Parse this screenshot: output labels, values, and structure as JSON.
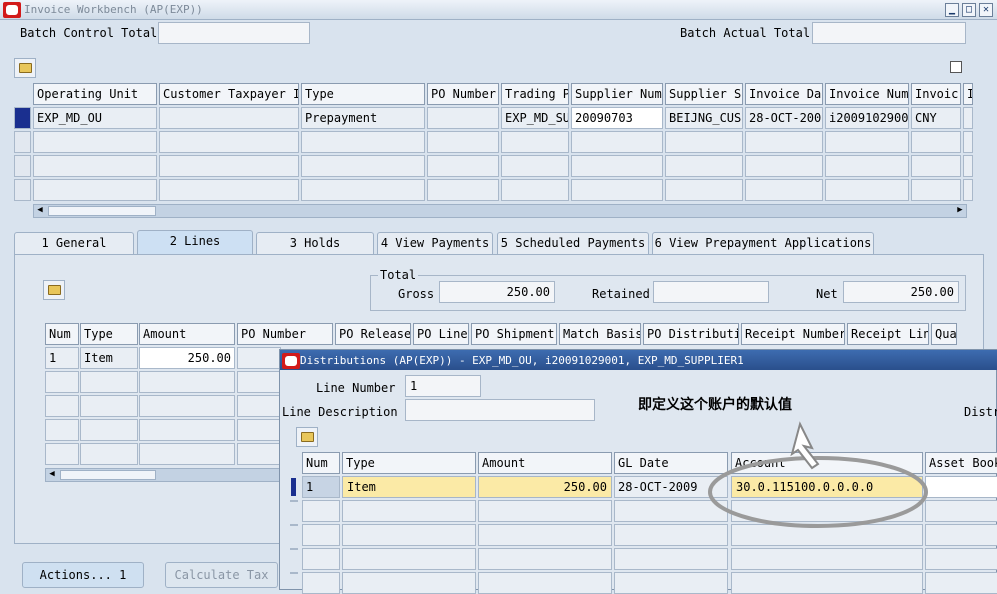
{
  "window": {
    "title": "Invoice Workbench (AP(EXP))"
  },
  "batch": {
    "control_label": "Batch Control Total",
    "actual_label": "Batch Actual Total"
  },
  "invoice_grid": {
    "columns": [
      "Operating Unit",
      "Customer Taxpayer I",
      "Type",
      "PO Number",
      "Trading P",
      "Supplier Num",
      "Supplier S:",
      "Invoice Dat",
      "Invoice Num",
      "Invoic",
      "I"
    ],
    "row": [
      "EXP_MD_OU",
      "",
      "Prepayment",
      "",
      "EXP_MD_SU",
      "20090703",
      "BEIJNG_CUS",
      "28-OCT-200:",
      "i2009102900:",
      "CNY"
    ]
  },
  "tabs": [
    "1 General",
    "2 Lines",
    "3 Holds",
    "4 View Payments",
    "5 Scheduled Payments",
    "6 View Prepayment Applications"
  ],
  "totals": {
    "heading": "Total",
    "gross_label": "Gross",
    "gross_value": "250.00",
    "retained_label": "Retained",
    "retained_value": "",
    "net_label": "Net",
    "net_value": "250.00"
  },
  "lines_grid": {
    "columns": [
      "Num",
      "Type",
      "Amount",
      "PO Number",
      "PO Release",
      "PO Line",
      "PO Shipment",
      "Match Basis",
      "PO Distributi",
      "Receipt Number",
      "Receipt Lin",
      "Qua"
    ],
    "row": [
      "1",
      "Item",
      "250.00"
    ]
  },
  "buttons": {
    "actions": "Actions... 1",
    "calc_tax": "Calculate Tax"
  },
  "dist": {
    "title": "Distributions (AP(EXP)) - EXP_MD_OU, i20091029001, EXP_MD_SUPPLIER1",
    "line_number_label": "Line Number",
    "line_number_value": "1",
    "line_desc_label": "Line Description",
    "line_desc_value": "",
    "dist_trunc": "Distr",
    "annotation": "即定义这个账户的默认值",
    "columns": [
      "Num",
      "Type",
      "Amount",
      "GL Date",
      "Account",
      "Asset Book"
    ],
    "row": [
      "1",
      "Item",
      "250.00",
      "28-OCT-2009",
      "30.0.115100.0.0.0.0",
      ""
    ]
  }
}
